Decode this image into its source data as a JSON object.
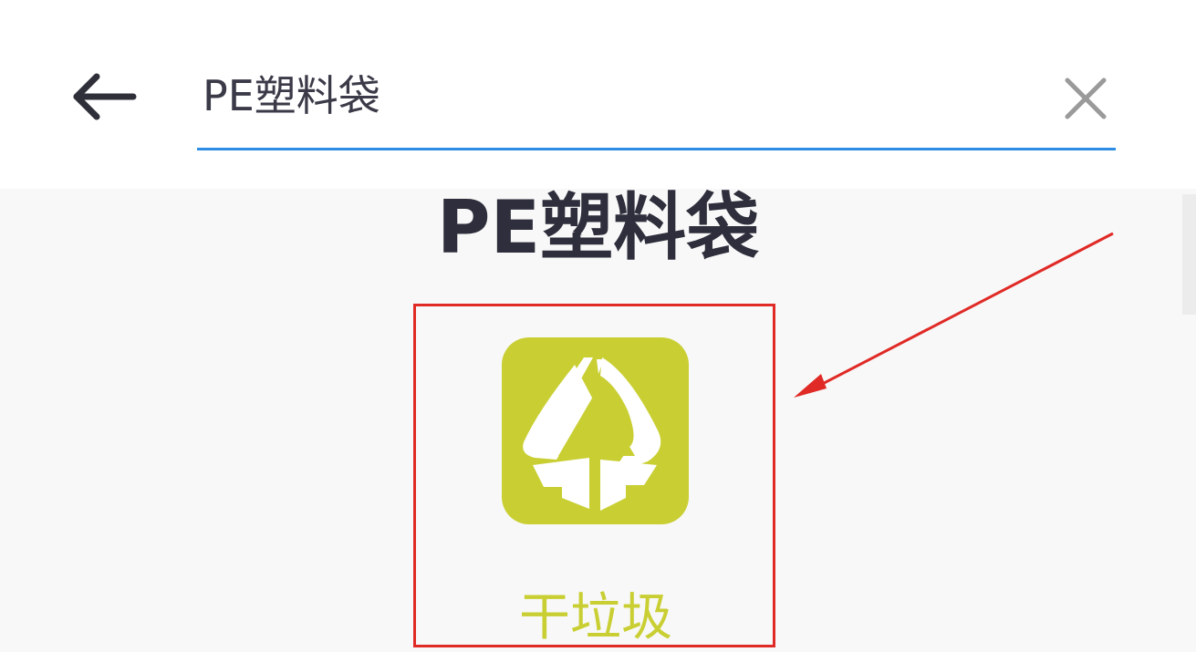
{
  "search": {
    "query": "PE塑料袋"
  },
  "result": {
    "title": "PE塑料袋",
    "category_label": "干垃圾",
    "category_color": "#c9cf33"
  },
  "icons": {
    "back": "arrow-left-icon",
    "clear": "close-icon",
    "category": "dry-waste-recycle-icon",
    "annotation": "red-arrow-annotation"
  },
  "colors": {
    "accent": "#2d8ce6",
    "annotation": "#e02a26",
    "title": "#2e2e3c"
  }
}
